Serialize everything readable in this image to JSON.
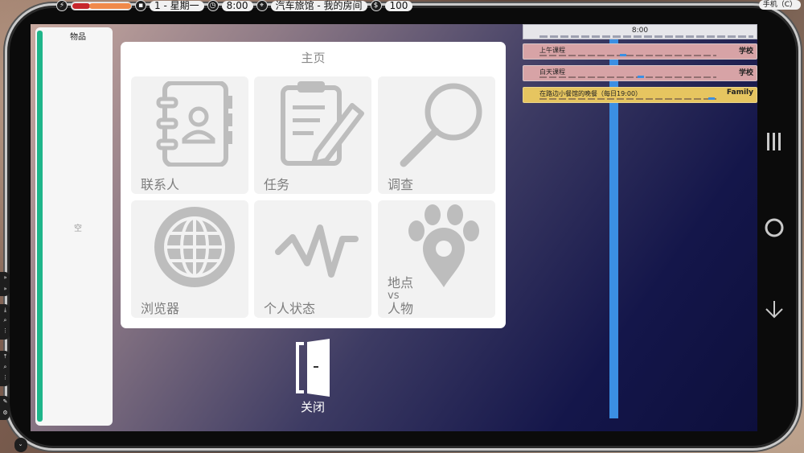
{
  "status_bar": {
    "energy_icon": "lightning-icon",
    "energy_level": 0.93,
    "calendar_icon": "calendar-icon",
    "day": "1 - 星期一",
    "clock_icon": "clock-icon",
    "time": "8:00",
    "location_icon": "location-pin-icon",
    "location": "汽车旅馆 - 我的房间",
    "money_icon": "dollar-icon",
    "money": "100",
    "phone_label": "手机（C）"
  },
  "inventory": {
    "title": "物品",
    "empty_text": "空"
  },
  "home": {
    "title": "主页",
    "tiles": [
      {
        "label": "联系人",
        "icon": "contacts-book-icon"
      },
      {
        "label": "任务",
        "icon": "clipboard-pen-icon"
      },
      {
        "label": "调查",
        "icon": "magnifier-icon"
      },
      {
        "label": "浏览器",
        "icon": "globe-icon"
      },
      {
        "label": "个人状态",
        "icon": "heartbeat-icon"
      },
      {
        "label": "地点\nvs\n人物",
        "line1": "地点",
        "line2": "vs",
        "line3": "人物",
        "icon": "paw-location-icon"
      }
    ]
  },
  "close": {
    "label": "关闭",
    "icon": "door-exit-icon"
  },
  "timeline": {
    "header_time": "8:00",
    "events": [
      {
        "name": "上午课程",
        "category": "学校",
        "color": "#d7a3a6"
      },
      {
        "name": "白天课程",
        "category": "学校",
        "color": "#d7a3a6"
      },
      {
        "name": "在路边小餐馆的晚餐（每日19:00）",
        "category": "Family",
        "color": "#e6c560"
      }
    ]
  },
  "colors": {
    "inventory_accent": "#1fb58a",
    "timeline_line": "#3b8fe3",
    "energy_red": "#c7262b",
    "energy_orange": "#f0894a"
  },
  "side_nav": {
    "menu_icon": "menu-lines-icon",
    "home_icon": "circle-home-icon",
    "back_icon": "down-arrow-icon"
  }
}
